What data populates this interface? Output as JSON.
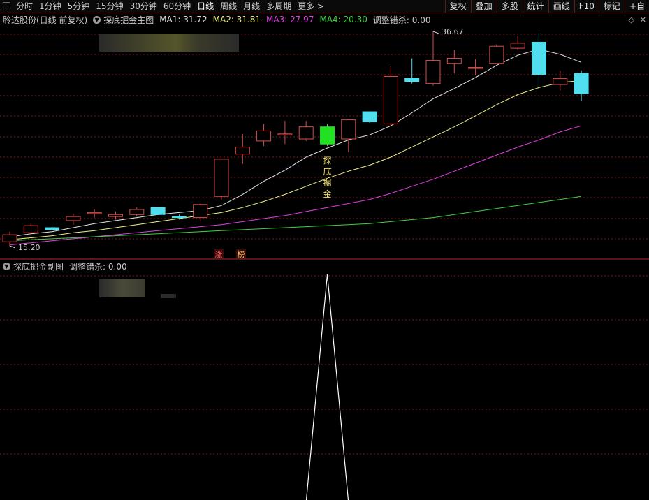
{
  "toolbar": {
    "timeframes": [
      "分时",
      "1分钟",
      "5分钟",
      "15分钟",
      "30分钟",
      "60分钟",
      "日线",
      "周线",
      "月线",
      "多周期",
      "更多 >"
    ],
    "active_timeframe": "日线",
    "right_buttons": [
      "复权",
      "叠加",
      "多股",
      "统计",
      "画线",
      "F10",
      "标记",
      "+自"
    ]
  },
  "main_panel": {
    "stock_title": "聆达股份(日线 前复权)",
    "indicator_name": "探底掘金主图",
    "ma": [
      {
        "label": "MA1: 31.72",
        "color": "#e6e6e6"
      },
      {
        "label": "MA2: 31.81",
        "color": "#f0f08a"
      },
      {
        "label": "MA3: 27.97",
        "color": "#e040e0"
      },
      {
        "label": "MA4: 20.30",
        "color": "#40d040"
      }
    ],
    "adjust_label": "调整错杀: 0.00",
    "high_label": "36.67",
    "low_label": "15.20",
    "signal_text": [
      "探",
      "底",
      "掘",
      "金"
    ],
    "badges": [
      "涨",
      "榜"
    ]
  },
  "sub_panel": {
    "indicator_name": "探底掘金副图",
    "adjust_label": "调整错杀: 0.00"
  },
  "chart_data": {
    "type": "candlestick",
    "candles": [
      {
        "o": 15.8,
        "c": 16.5,
        "h": 16.8,
        "l": 15.4
      },
      {
        "o": 16.7,
        "c": 17.4,
        "h": 17.6,
        "l": 16.6
      },
      {
        "o": 17.2,
        "c": 17.0,
        "h": 17.4,
        "l": 16.9
      },
      {
        "o": 17.9,
        "c": 18.3,
        "h": 18.6,
        "l": 17.5
      },
      {
        "o": 18.6,
        "c": 18.7,
        "h": 19.0,
        "l": 18.2
      },
      {
        "o": 18.3,
        "c": 18.5,
        "h": 18.8,
        "l": 18.0
      },
      {
        "o": 18.5,
        "c": 19.0,
        "h": 19.2,
        "l": 18.3
      },
      {
        "o": 19.2,
        "c": 18.5,
        "h": 19.2,
        "l": 18.5
      },
      {
        "o": 18.3,
        "c": 18.2,
        "h": 18.5,
        "l": 18.0
      },
      {
        "o": 18.2,
        "c": 19.5,
        "h": 19.6,
        "l": 17.8
      },
      {
        "o": 20.3,
        "c": 24.0,
        "h": 24.0,
        "l": 20.0
      },
      {
        "o": 24.5,
        "c": 25.2,
        "h": 26.5,
        "l": 23.5
      },
      {
        "o": 25.8,
        "c": 26.8,
        "h": 27.5,
        "l": 25.3
      },
      {
        "o": 26.5,
        "c": 26.5,
        "h": 27.8,
        "l": 25.5
      },
      {
        "o": 26.0,
        "c": 27.2,
        "h": 27.8,
        "l": 25.8
      },
      {
        "o": 27.2,
        "c": 25.5,
        "h": 27.5,
        "l": 25.3
      },
      {
        "o": 26.0,
        "c": 27.9,
        "h": 27.9,
        "l": 24.7
      },
      {
        "o": 28.7,
        "c": 27.7,
        "h": 28.7,
        "l": 27.6
      },
      {
        "o": 27.5,
        "c": 32.2,
        "h": 33.2,
        "l": 27.3
      },
      {
        "o": 32.0,
        "c": 31.7,
        "h": 34.0,
        "l": 31.5
      },
      {
        "o": 31.5,
        "c": 33.8,
        "h": 36.67,
        "l": 31.3
      },
      {
        "o": 33.5,
        "c": 34.0,
        "h": 34.8,
        "l": 32.5
      },
      {
        "o": 33.0,
        "c": 33.1,
        "h": 33.9,
        "l": 32.3
      },
      {
        "o": 33.5,
        "c": 35.2,
        "h": 35.4,
        "l": 33.4
      },
      {
        "o": 35.0,
        "c": 35.5,
        "h": 36.2,
        "l": 34.8
      },
      {
        "o": 35.6,
        "c": 32.4,
        "h": 36.5,
        "l": 31.4
      },
      {
        "o": 31.4,
        "c": 32.0,
        "h": 32.8,
        "l": 30.8
      },
      {
        "o": 32.5,
        "c": 30.5,
        "h": 32.8,
        "l": 29.8
      }
    ],
    "signal_candle_index": 15,
    "ma_series": [
      {
        "name": "MA1",
        "values": [
          16.3,
          16.6,
          16.8,
          17.2,
          17.6,
          17.9,
          18.2,
          18.5,
          18.7,
          18.9,
          19.4,
          20.5,
          21.8,
          22.9,
          24.2,
          25.1,
          25.9,
          26.4,
          27.3,
          28.6,
          30.0,
          31.0,
          32.1,
          33.3,
          34.3,
          34.9,
          34.4,
          33.6
        ]
      },
      {
        "name": "MA2",
        "values": [
          16.0,
          16.2,
          16.4,
          16.7,
          16.9,
          17.2,
          17.5,
          17.8,
          18.1,
          18.4,
          18.7,
          19.2,
          19.8,
          20.5,
          21.3,
          22.1,
          22.8,
          23.4,
          24.2,
          25.2,
          26.2,
          27.2,
          28.3,
          29.4,
          30.4,
          31.1,
          31.6,
          31.8
        ]
      },
      {
        "name": "MA3",
        "values": [
          15.5,
          15.7,
          15.9,
          16.1,
          16.3,
          16.5,
          16.7,
          16.9,
          17.1,
          17.3,
          17.5,
          17.8,
          18.1,
          18.4,
          18.8,
          19.2,
          19.6,
          20.0,
          20.6,
          21.3,
          22.0,
          22.8,
          23.6,
          24.4,
          25.2,
          25.9,
          26.7,
          27.3
        ]
      },
      {
        "name": "MA4",
        "values": [
          15.9,
          16.0,
          16.1,
          16.2,
          16.3,
          16.4,
          16.5,
          16.6,
          16.7,
          16.8,
          16.9,
          17.0,
          17.1,
          17.2,
          17.3,
          17.4,
          17.5,
          17.6,
          17.8,
          18.0,
          18.2,
          18.5,
          18.8,
          19.1,
          19.4,
          19.7,
          20.0,
          20.3
        ]
      }
    ],
    "sub_signal_index": 15
  },
  "colors": {
    "up": "#e04848",
    "down": "#4fdfef",
    "signal": "#22e022",
    "grid": "#7a1c1c",
    "ma1": "#e6e6e6",
    "ma2": "#f0f08a",
    "ma3": "#e040e0",
    "ma4": "#40d040",
    "sub_line": "#ffffff"
  }
}
